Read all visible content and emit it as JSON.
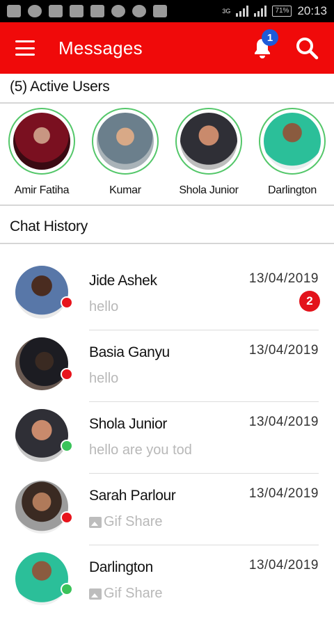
{
  "status_bar": {
    "signal_label": "3G",
    "battery": "71%",
    "time": "20:13"
  },
  "app_bar": {
    "title": "Messages",
    "notification_count": "1"
  },
  "active_users": {
    "heading": "(5) Active Users",
    "users": [
      {
        "name": "Amir Fatiha"
      },
      {
        "name": "Kumar"
      },
      {
        "name": "Shola Junior"
      },
      {
        "name": "Darlington"
      }
    ]
  },
  "chat_history": {
    "heading": "Chat History",
    "chats": [
      {
        "name": "Jide Ashek",
        "date": "13/04/2019",
        "message": "hello",
        "unread": "2",
        "status": "offline"
      },
      {
        "name": "Basia Ganyu",
        "date": "13/04/2019",
        "message": "hello",
        "status": "offline"
      },
      {
        "name": "Shola Junior",
        "date": "13/04/2019",
        "message": "hello are you tod",
        "status": "online"
      },
      {
        "name": "Sarah Parlour",
        "date": "13/04/2019",
        "message": "Gif Share",
        "status": "offline"
      },
      {
        "name": "Darlington",
        "date": "13/04/2019",
        "message": "Gif Share",
        "status": "online"
      }
    ]
  },
  "colors": {
    "app_bar": "#f00a0a",
    "online": "#3ac35a",
    "offline": "#e8141c",
    "badge_blue": "#1f5bd9"
  }
}
